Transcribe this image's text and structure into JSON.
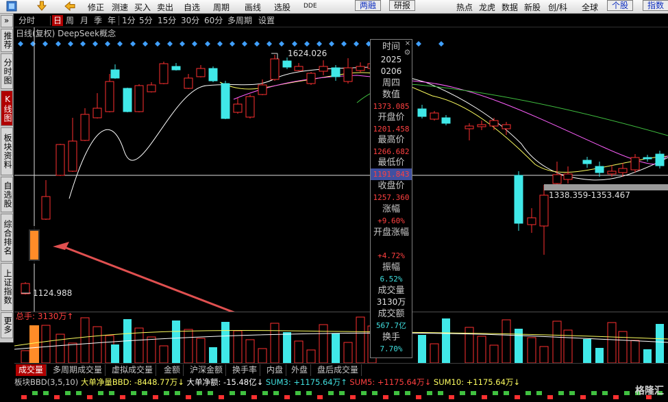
{
  "toolbar": {
    "items": [
      "修正",
      "测速",
      "买入",
      "卖出",
      "自选",
      "周期",
      "画线",
      "选股",
      "DDE"
    ],
    "boxed_items": [
      "两融",
      "研报"
    ],
    "right_items": [
      "热点",
      "龙虎",
      "数据",
      "新股",
      "创/科",
      "全球"
    ],
    "right_boxed": [
      "个股",
      "指数"
    ]
  },
  "sidebar": {
    "items": [
      "推荐",
      "分时图",
      "K线图",
      "板块资料",
      "自选股",
      "综合排名",
      "上证指数",
      "更多"
    ],
    "collapse_icon": "»"
  },
  "period_tabs": [
    "分时",
    "日",
    "周",
    "月",
    "季",
    "年",
    "1分",
    "5分",
    "15分",
    "30分",
    "60分",
    "多周期",
    "设置"
  ],
  "period_active": "日",
  "chart": {
    "title": "日线(复权)  DeepSeek概念",
    "high_label": "1624.026",
    "low_label": "1124.988",
    "range_label": "1338.359-1353.467",
    "volume_label": "总手: 3130万↑"
  },
  "info_panel": {
    "rows": [
      {
        "label": "时间",
        "value": null
      },
      {
        "label": "2025",
        "value": null
      },
      {
        "label": "0206",
        "value": null
      },
      {
        "label": "周四",
        "value": null
      },
      {
        "label": "数值",
        "value": "1373.085"
      },
      {
        "label": "开盘价",
        "value": "1201.458"
      },
      {
        "label": "最高价",
        "value": "1266.682"
      },
      {
        "label": "最低价",
        "value": "1191.843"
      },
      {
        "label": "收盘价",
        "value": "1257.360"
      },
      {
        "label": "涨幅",
        "value": "+9.60%"
      },
      {
        "label": "开盘涨幅",
        "value": "+4.72%"
      },
      {
        "label": "振幅",
        "value": "6.52%"
      },
      {
        "label": "成交量",
        "value": "3130万"
      },
      {
        "label": "成交额",
        "value": "567.7亿"
      },
      {
        "label": "换手",
        "value": "7.70%"
      }
    ],
    "close_icon": "×",
    "gear_icon": "⚙"
  },
  "bottom_tabs": [
    "成交量",
    "多周期成交量",
    "虚拟成交量",
    "金额",
    "沪深金额",
    "换手率",
    "内盘",
    "外盘",
    "盘后成交量"
  ],
  "bottom_active": "成交量",
  "bbd": {
    "name": "板块BBD(3,5,10)",
    "big_net_bbd": "大单净量BBD: -8448.77万↓",
    "big_net_amount": "大单净额: -15.48亿↓",
    "sum3": "SUM3: +1175.64万↑",
    "sum5": "SUM5: +1175.64万↓",
    "sum10": "SUM10: +1175.64万↓"
  },
  "watermark": "格隆汇",
  "colors": {
    "up": "#ff3030",
    "down": "#40e8e8",
    "highlight": "#ff8c28",
    "ma5": "#ffffff",
    "ma10": "#ffff60",
    "ma20": "#ff60ff",
    "ma60": "#40c040"
  }
}
